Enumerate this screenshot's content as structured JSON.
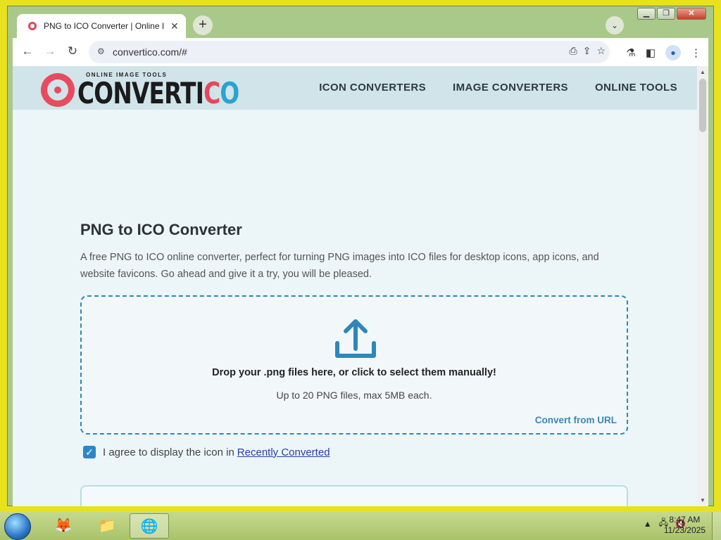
{
  "browser": {
    "tab_title": "PNG to ICO Converter | Online I",
    "tab_close": "✕",
    "new_tab": "+",
    "tab_search": "⌄",
    "url": "convertico.com/#",
    "back": "←",
    "forward": "→",
    "reload": "↻"
  },
  "site": {
    "logo_tag": "ONLINE IMAGE TOOLS",
    "logo_word_main": "CONVERT",
    "logo_word_i": "I",
    "logo_word_c": "C",
    "logo_word_o": "O",
    "nav": [
      "ICON CONVERTERS",
      "IMAGE CONVERTERS",
      "ONLINE TOOLS"
    ]
  },
  "content": {
    "title": "PNG to ICO Converter",
    "lead": "A free PNG to ICO online converter, perfect for turning PNG images into ICO files for desktop icons, app icons, and website favicons. Go ahead and give it a try, you will be pleased.",
    "drop_main": "Drop your .png files here, or click to select them manually!",
    "drop_sub": "Up to 20 PNG files, max 5MB each.",
    "convert_url": "Convert from URL",
    "agree_text": "I agree to display the icon in",
    "agree_link": "Recently Converted",
    "agree_checked": true
  },
  "taskbar": {
    "time": "8:47 AM",
    "date": "11/23/2025"
  },
  "colors": {
    "accent": "#2e87b8",
    "logo_red": "#e84a5f",
    "header_bg": "#d0e4ea"
  }
}
